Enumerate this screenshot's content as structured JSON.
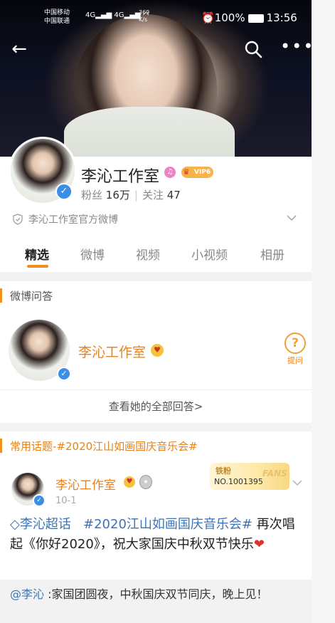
{
  "status_bar": {
    "carrier_1": "中国移动",
    "carrier_2": "中国联通",
    "network_1": "4G",
    "network_2": "4G",
    "speed_value": "369",
    "speed_unit": "K/s",
    "battery": "100%",
    "time": "13:56"
  },
  "profile": {
    "name": "李沁工作室",
    "vip_label": "VIP6",
    "fans_label": "粉丝",
    "fans_count": "16万",
    "follow_label": "关注",
    "follow_count": "47",
    "official_text": "李沁工作室官方微博"
  },
  "tabs": [
    {
      "label": "精选",
      "active": true
    },
    {
      "label": "微博",
      "active": false
    },
    {
      "label": "视频",
      "active": false
    },
    {
      "label": "小视频",
      "active": false
    },
    {
      "label": "相册",
      "active": false
    }
  ],
  "qa_section": {
    "title": "微博问答",
    "name": "李沁工作室",
    "ask_label": "提问",
    "view_all": "查看她的全部回答>"
  },
  "topic_section": {
    "title": "常用话题-#2020江山如画国庆音乐会#"
  },
  "post": {
    "author": "李沁工作室",
    "time": "10-1",
    "fans_card_label": "铁粉",
    "fans_card_no": "NO.1001395",
    "fans_card_brand": "FANS",
    "supertopic": "李沁超话",
    "hashtag": "#2020江山如画国庆音乐会#",
    "text": " 再次唱起《你好2020》，祝大家国庆中秋双节快乐",
    "emoji": "❤"
  },
  "repost": {
    "mention": "@李沁",
    "text": ":家国团圆夜，中秋国庆双节同庆，晚上见！"
  },
  "colors": {
    "accent": "#f18f1c",
    "name_orange": "#e8821a",
    "link_blue": "#3a74b8",
    "verified_blue": "#3a8ee6"
  }
}
